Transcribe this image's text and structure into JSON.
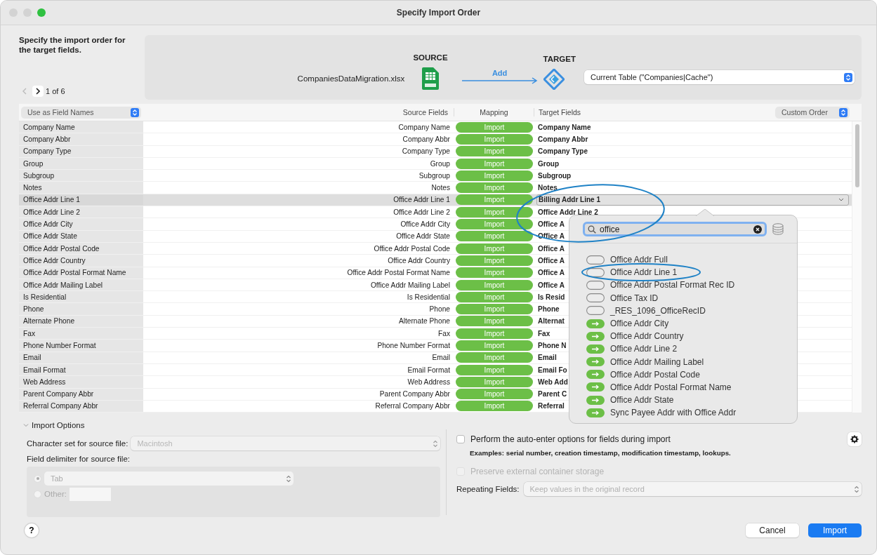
{
  "window": {
    "title": "Specify Import Order"
  },
  "instructions": "Specify the import order for the target fields.",
  "pager": {
    "label": "1 of 6",
    "prev_disabled": true
  },
  "source": {
    "heading": "SOURCE",
    "file": "CompaniesDataMigration.xlsx"
  },
  "action_label": "Add",
  "target": {
    "heading": "TARGET",
    "table": "Current Table (\"Companies|Cache\")"
  },
  "table": {
    "first_row_option": "Use as Field Names",
    "columns": [
      "Source Fields",
      "Mapping",
      "Target Fields"
    ],
    "order": "Custom Order",
    "rows": [
      {
        "name": "Company Name",
        "source": "Company Name",
        "mapping": "Import",
        "target": "Company Name",
        "selected": false
      },
      {
        "name": "Company Abbr",
        "source": "Company Abbr",
        "mapping": "Import",
        "target": "Company Abbr",
        "selected": false
      },
      {
        "name": "Company Type",
        "source": "Company Type",
        "mapping": "Import",
        "target": "Company Type",
        "selected": false
      },
      {
        "name": "Group",
        "source": "Group",
        "mapping": "Import",
        "target": "Group",
        "selected": false
      },
      {
        "name": "Subgroup",
        "source": "Subgroup",
        "mapping": "Import",
        "target": "Subgroup",
        "selected": false
      },
      {
        "name": "Notes",
        "source": "Notes",
        "mapping": "Import",
        "target": "Notes",
        "selected": false
      },
      {
        "name": "Office Addr Line 1",
        "source": "Office Addr Line 1",
        "mapping": "Import",
        "target": "Billing Addr Line 1",
        "selected": true
      },
      {
        "name": "Office Addr Line 2",
        "source": "Office Addr Line 2",
        "mapping": "Import",
        "target": "Office Addr Line 2",
        "selected": false
      },
      {
        "name": "Office Addr City",
        "source": "Office Addr City",
        "mapping": "Import",
        "target": "Office A",
        "selected": false
      },
      {
        "name": "Office Addr State",
        "source": "Office Addr State",
        "mapping": "Import",
        "target": "Office A",
        "selected": false
      },
      {
        "name": "Office Addr Postal Code",
        "source": "Office Addr Postal Code",
        "mapping": "Import",
        "target": "Office A",
        "selected": false
      },
      {
        "name": "Office Addr Country",
        "source": "Office Addr Country",
        "mapping": "Import",
        "target": "Office A",
        "selected": false
      },
      {
        "name": "Office Addr Postal Format Name",
        "source": "Office Addr Postal Format Name",
        "mapping": "Import",
        "target": "Office A",
        "selected": false
      },
      {
        "name": "Office Addr Mailing Label",
        "source": "Office Addr Mailing Label",
        "mapping": "Import",
        "target": "Office A",
        "selected": false
      },
      {
        "name": "Is Residential",
        "source": "Is Residential",
        "mapping": "Import",
        "target": "Is Resid",
        "selected": false
      },
      {
        "name": "Phone",
        "source": "Phone",
        "mapping": "Import",
        "target": "Phone",
        "selected": false
      },
      {
        "name": "Alternate Phone",
        "source": "Alternate Phone",
        "mapping": "Import",
        "target": "Alternat",
        "selected": false
      },
      {
        "name": "Fax",
        "source": "Fax",
        "mapping": "Import",
        "target": "Fax",
        "selected": false
      },
      {
        "name": "Phone Number Format",
        "source": "Phone Number Format",
        "mapping": "Import",
        "target": "Phone N",
        "selected": false
      },
      {
        "name": "Email",
        "source": "Email",
        "mapping": "Import",
        "target": "Email",
        "selected": false
      },
      {
        "name": "Email Format",
        "source": "Email Format",
        "mapping": "Import",
        "target": "Email Fo",
        "selected": false
      },
      {
        "name": "Web Address",
        "source": "Web Address",
        "mapping": "Import",
        "target": "Web Add",
        "selected": false
      },
      {
        "name": "Parent Company Abbr",
        "source": "Parent Company Abbr",
        "mapping": "Import",
        "target": "Parent C",
        "selected": false
      },
      {
        "name": "Referral Company Abbr",
        "source": "Referral Company Abbr",
        "mapping": "Import",
        "target": "Referral",
        "selected": false
      }
    ]
  },
  "field_picker": {
    "search": "office",
    "items": [
      {
        "label": "Office Addr Full",
        "kind": "unmapped"
      },
      {
        "label": "Office Addr Line 1",
        "kind": "unmapped"
      },
      {
        "label": "Office Addr Postal Format Rec ID",
        "kind": "unmapped"
      },
      {
        "label": "Office Tax ID",
        "kind": "unmapped"
      },
      {
        "label": "_RES_1096_OfficeRecID",
        "kind": "unmapped"
      },
      {
        "label": "Office Addr City",
        "kind": "mapped"
      },
      {
        "label": "Office Addr Country",
        "kind": "mapped"
      },
      {
        "label": "Office Addr Line 2",
        "kind": "mapped"
      },
      {
        "label": "Office Addr Mailing Label",
        "kind": "mapped"
      },
      {
        "label": "Office Addr Postal Code",
        "kind": "mapped"
      },
      {
        "label": "Office Addr Postal Format Name",
        "kind": "mapped"
      },
      {
        "label": "Office Addr State",
        "kind": "mapped"
      },
      {
        "label": "Sync Payee Addr with Office Addr",
        "kind": "mapped"
      }
    ]
  },
  "import_options": {
    "title": "Import Options",
    "expanded": true,
    "charset_label": "Character set for source file:",
    "charset": "Macintosh",
    "charset_disabled": true,
    "delimiter_label": "Field delimiter for source file:",
    "delimiters": [
      {
        "label": "Tab",
        "selected": true,
        "kind": "popup",
        "disabled": true
      },
      {
        "label": "Other:",
        "selected": false,
        "kind": "text",
        "disabled": true
      }
    ],
    "auto_enter": {
      "label": "Perform the auto-enter options for fields during import",
      "checked": false,
      "disabled": false
    },
    "auto_enter_note": "Examples: serial number, creation timestamp, modification timestamp, lookups.",
    "preserve": {
      "label": "Preserve external container storage",
      "checked": false,
      "disabled": true
    },
    "repeating_label": "Repeating Fields:",
    "repeating": "Keep values in the original record",
    "repeating_disabled": true
  },
  "help": "?",
  "buttons": [
    {
      "label": "Cancel",
      "kind": "secondary"
    },
    {
      "label": "Import",
      "kind": "primary"
    }
  ]
}
